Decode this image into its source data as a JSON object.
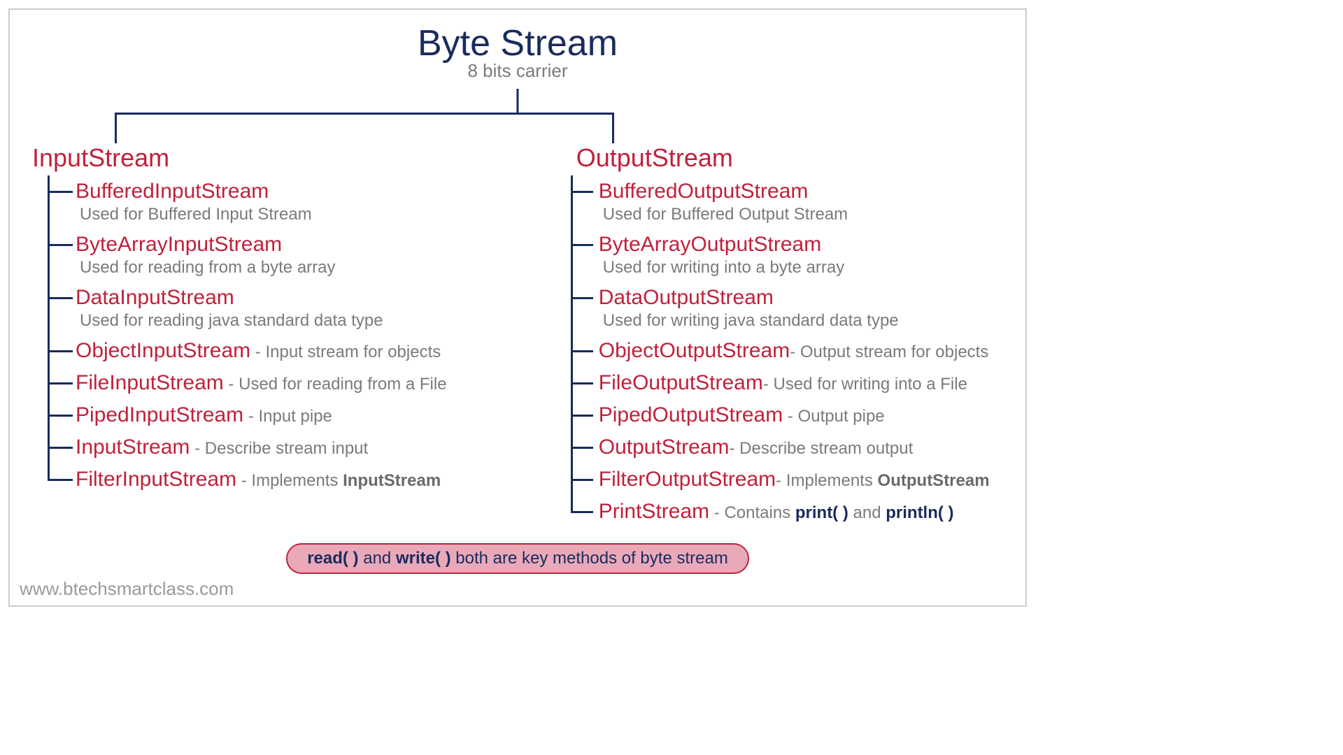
{
  "header": {
    "title": "Byte Stream",
    "subtitle": "8 bits carrier"
  },
  "left": {
    "title": "InputStream",
    "items": [
      {
        "name": "BufferedInputStream",
        "desc": "Used for Buffered Input Stream",
        "inline": false
      },
      {
        "name": "ByteArrayInputStream",
        "desc": "Used for reading from a byte array",
        "inline": false
      },
      {
        "name": "DataInputStream",
        "desc": "Used for reading java standard data type",
        "inline": false
      },
      {
        "name": "ObjectInputStream",
        "desc_pre": "  - Input stream for objects",
        "inline": true
      },
      {
        "name": "FileInputStream",
        "desc_pre": " - Used for reading from a File",
        "inline": true
      },
      {
        "name": "PipedInputStream",
        "desc_pre": " - Input pipe",
        "inline": true
      },
      {
        "name": "InputStream",
        "desc_pre": "  - Describe stream input",
        "inline": true
      },
      {
        "name": "FilterInputStream",
        "desc_pre": "  - Implements ",
        "desc_bold": "InputStream",
        "inline": true
      }
    ]
  },
  "right": {
    "title": "OutputStream",
    "items": [
      {
        "name": "BufferedOutputStream",
        "desc": "Used for Buffered Output Stream",
        "inline": false
      },
      {
        "name": "ByteArrayOutputStream",
        "desc": "Used for writing into a byte array",
        "inline": false
      },
      {
        "name": "DataOutputStream",
        "desc": "Used for writing java standard data type",
        "inline": false
      },
      {
        "name": "ObjectOutputStream",
        "desc_pre": "- Output stream for objects",
        "inline": true
      },
      {
        "name": "FileOutputStream",
        "desc_pre": "- Used for writing into a File",
        "inline": true
      },
      {
        "name": "PipedOutputStream",
        "desc_pre": " - Output pipe",
        "inline": true
      },
      {
        "name": "OutputStream",
        "desc_pre": "- Describe stream output",
        "inline": true
      },
      {
        "name": "FilterOutputStream",
        "desc_pre": "- Implements ",
        "desc_bold": "OutputStream",
        "inline": true
      },
      {
        "name": "PrintStream",
        "desc_pre": "   - Contains ",
        "desc_navy1": "print( )",
        "desc_mid": " and ",
        "desc_navy2": "println( )",
        "inline": true
      }
    ]
  },
  "footer": {
    "b1": "read( )",
    "mid1": " and ",
    "b2": "write( )",
    "rest": " both are key methods of byte stream"
  },
  "watermark": "www.btechsmartclass.com"
}
